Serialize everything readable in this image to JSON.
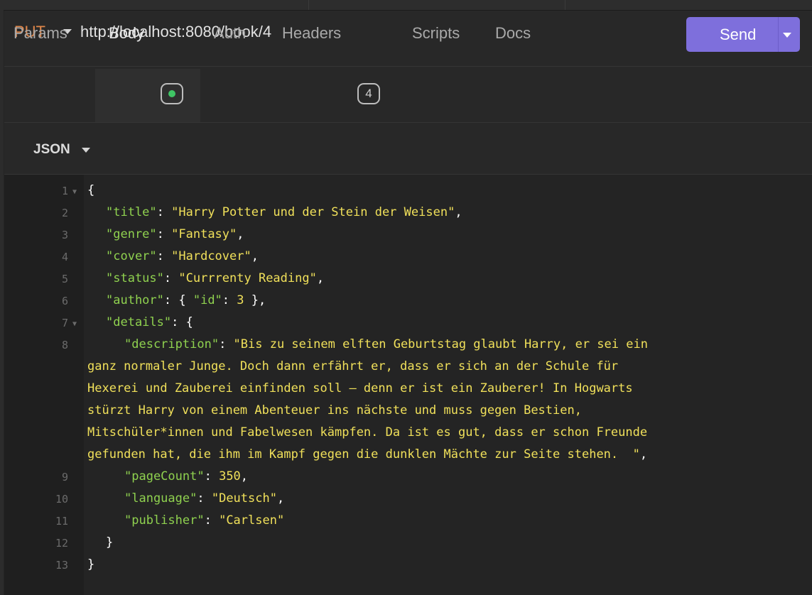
{
  "request": {
    "method": "PUT",
    "url": "http://localhost:8080/book/4",
    "send_label": "Send"
  },
  "tabs": [
    {
      "label": "Params"
    },
    {
      "label": "Body"
    },
    {
      "label": "Auth"
    },
    {
      "label": "Headers",
      "badge": "4"
    },
    {
      "label": "Scripts"
    },
    {
      "label": "Docs"
    }
  ],
  "body_format": "JSON",
  "editor": {
    "line_numbers": [
      "1",
      "2",
      "3",
      "4",
      "5",
      "6",
      "7",
      "8",
      "9",
      "10",
      "11",
      "12",
      "13"
    ],
    "lines": [
      {
        "id": "l1",
        "parts": [
          {
            "t": "p",
            "v": "{"
          }
        ]
      },
      {
        "id": "l2",
        "parts": [
          {
            "t": "k",
            "v": "\"title\""
          },
          {
            "t": "p",
            "v": ": "
          },
          {
            "t": "s",
            "v": "\"Harry Potter und der Stein der Weisen\""
          },
          {
            "t": "p",
            "v": ","
          }
        ]
      },
      {
        "id": "l3",
        "parts": [
          {
            "t": "k",
            "v": "\"genre\""
          },
          {
            "t": "p",
            "v": ": "
          },
          {
            "t": "s",
            "v": "\"Fantasy\""
          },
          {
            "t": "p",
            "v": ","
          }
        ]
      },
      {
        "id": "l4",
        "parts": [
          {
            "t": "k",
            "v": "\"cover\""
          },
          {
            "t": "p",
            "v": ": "
          },
          {
            "t": "s",
            "v": "\"Hardcover\""
          },
          {
            "t": "p",
            "v": ","
          }
        ]
      },
      {
        "id": "l5",
        "parts": [
          {
            "t": "k",
            "v": "\"status\""
          },
          {
            "t": "p",
            "v": ": "
          },
          {
            "t": "s",
            "v": "\"Currrenty Reading\""
          },
          {
            "t": "p",
            "v": ","
          }
        ]
      },
      {
        "id": "l6",
        "parts": [
          {
            "t": "k",
            "v": "\"author\""
          },
          {
            "t": "p",
            "v": ": { "
          },
          {
            "t": "k",
            "v": "\"id\""
          },
          {
            "t": "p",
            "v": ": "
          },
          {
            "t": "n",
            "v": "3"
          },
          {
            "t": "p",
            "v": " },"
          }
        ]
      },
      {
        "id": "l7",
        "parts": [
          {
            "t": "k",
            "v": "\"details\""
          },
          {
            "t": "p",
            "v": ": {"
          }
        ]
      },
      {
        "id": "l8a",
        "parts": [
          {
            "t": "k",
            "v": "\"description\""
          },
          {
            "t": "p",
            "v": ": "
          },
          {
            "t": "s",
            "v": "\"Bis zu seinem elften Geburtstag glaubt Harry, er sei ein"
          }
        ]
      },
      {
        "id": "l8b",
        "parts": [
          {
            "t": "s",
            "v": "ganz normaler Junge. Doch dann erfährt er, dass er sich an der Schule für"
          }
        ]
      },
      {
        "id": "l8c",
        "parts": [
          {
            "t": "s",
            "v": "Hexerei und Zauberei einfinden soll – denn er ist ein Zauberer! In Hogwarts"
          }
        ]
      },
      {
        "id": "l8d",
        "parts": [
          {
            "t": "s",
            "v": "stürzt Harry von einem Abenteuer ins nächste und muss gegen Bestien,"
          }
        ]
      },
      {
        "id": "l8e",
        "parts": [
          {
            "t": "s",
            "v": "Mitschüler*innen und Fabelwesen kämpfen. Da ist es gut, dass er schon Freunde"
          }
        ]
      },
      {
        "id": "l8f",
        "parts": [
          {
            "t": "s",
            "v": "gefunden hat, die ihm im Kampf gegen die dunklen Mächte zur Seite stehen.  \""
          },
          {
            "t": "p",
            "v": ","
          }
        ]
      },
      {
        "id": "l9",
        "parts": [
          {
            "t": "k",
            "v": "\"pageCount\""
          },
          {
            "t": "p",
            "v": ": "
          },
          {
            "t": "n",
            "v": "350"
          },
          {
            "t": "p",
            "v": ","
          }
        ]
      },
      {
        "id": "l10",
        "parts": [
          {
            "t": "k",
            "v": "\"language\""
          },
          {
            "t": "p",
            "v": ": "
          },
          {
            "t": "s",
            "v": "\"Deutsch\""
          },
          {
            "t": "p",
            "v": ","
          }
        ]
      },
      {
        "id": "l11",
        "parts": [
          {
            "t": "k",
            "v": "\"publisher\""
          },
          {
            "t": "p",
            "v": ": "
          },
          {
            "t": "s",
            "v": "\"Carlsen\""
          }
        ]
      },
      {
        "id": "l12",
        "parts": [
          {
            "t": "p",
            "v": "}"
          }
        ]
      },
      {
        "id": "l13",
        "parts": [
          {
            "t": "p",
            "v": "}"
          }
        ]
      }
    ]
  },
  "colors": {
    "accent": "#7e6fdc",
    "method": "#e0874a",
    "body_dot": "#3fc565",
    "json_key": "#8fd14f",
    "json_string": "#f0e05a"
  }
}
